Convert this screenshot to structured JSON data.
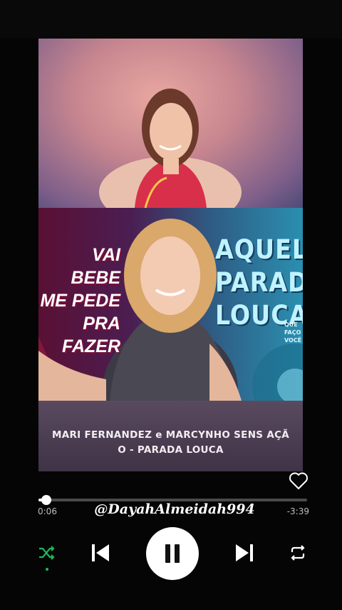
{
  "track": {
    "title": "MARI FERNANDEZ e MARCYNHO SENS AÇÃO - PARADA LOUCA",
    "cover_left_text": [
      "VAI BEBE",
      "ME PEDE",
      "PRA FAZER"
    ],
    "cover_right_text": [
      "AQUELAS",
      "PARADAS",
      "LOUCA"
    ],
    "cover_right_small": [
      "QUE",
      "FAÇO",
      "VOCÊ"
    ]
  },
  "player": {
    "elapsed": "0:06",
    "remaining": "-3:39",
    "progress_fraction": 0.03,
    "watermark": "@DayahAlmeidah994",
    "liked": false,
    "shuffle_active": true,
    "state": "playing"
  },
  "icons": {
    "like": "heart-outline-icon",
    "shuffle": "shuffle-icon",
    "previous": "skip-previous-icon",
    "play_pause": "pause-icon",
    "next": "skip-next-icon",
    "repeat": "repeat-icon"
  },
  "colors": {
    "accent": "#1db954",
    "background": "#000000",
    "caption_band": "#4a3d52"
  }
}
